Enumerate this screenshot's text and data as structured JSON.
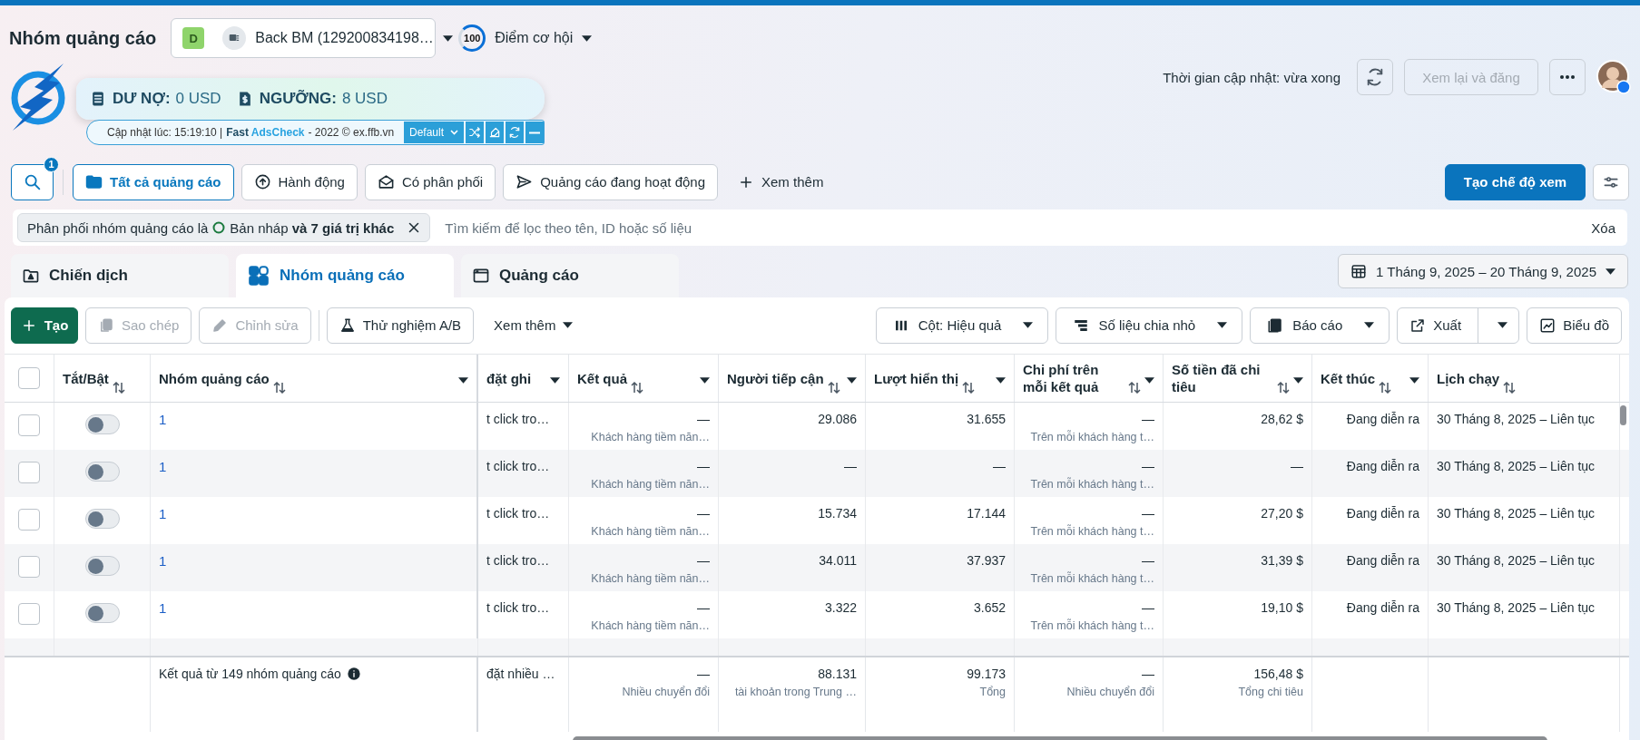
{
  "header": {
    "title": "Nhóm quảng cáo",
    "account": {
      "badge": "D",
      "name": "Back BM (129200834198…"
    },
    "score": {
      "value": "100",
      "label": "Điểm cơ hội"
    },
    "update_time": "Thời gian cập nhật: vừa xong",
    "review_button": {
      "label": "Xem lại và đăng",
      "disabled": true
    }
  },
  "extension": {
    "debt_label": "DƯ NỢ:",
    "debt": "0 USD",
    "threshold_label": "NGƯỠNG:",
    "threshold": "8 USD",
    "updated": "Cập nhật lúc: 15:19:10 |",
    "brand": [
      "Fast",
      "AdsCheck"
    ],
    "credit": "- 2022 © ex.ffb.vn",
    "profile": "Default"
  },
  "view_bar": {
    "search_badge": "1",
    "items": [
      {
        "label": "Tất cả quảng cáo",
        "selected": true
      },
      {
        "label": "Hành động",
        "selected": false
      },
      {
        "label": "Có phân phối",
        "selected": false
      },
      {
        "label": "Quảng cáo đang hoạt động",
        "selected": false
      }
    ],
    "more": "Xem thêm",
    "create_view": "Tạo chế độ xem"
  },
  "filter": {
    "chip_prefix": "Phân phối nhóm quảng cáo là",
    "chip_value": "Bản nháp **và 7 giá trị khác**",
    "placeholder": "Tìm kiếm để lọc theo tên, ID hoặc số liệu",
    "clear": "Xóa"
  },
  "levels": {
    "tabs": [
      {
        "label": "Chiến dịch",
        "selected": false
      },
      {
        "label": "Nhóm quảng cáo",
        "selected": true
      },
      {
        "label": "Quảng cáo",
        "selected": false
      }
    ],
    "date_range": "1 Tháng 9, 2025 – 20 Tháng 9, 2025"
  },
  "actions": {
    "left": [
      {
        "label": "Tạo",
        "kind": "primary",
        "disabled": false
      },
      {
        "label": "Sao chép",
        "kind": "plain",
        "disabled": true
      },
      {
        "label": "Chỉnh sửa",
        "kind": "plain",
        "disabled": true
      },
      {
        "label": "Thử nghiệm A/B",
        "kind": "plain",
        "disabled": false
      },
      {
        "label": "Xem thêm",
        "kind": "ghost",
        "disabled": false
      }
    ],
    "right": [
      {
        "label": "Cột: Hiệu quả",
        "kind": "menu"
      },
      {
        "label": "Số liệu chia nhỏ",
        "kind": "menu"
      },
      {
        "label": "Báo cáo",
        "kind": "menu"
      },
      {
        "label": "Xuất",
        "kind": "split"
      },
      {
        "label": "Biểu đồ",
        "kind": "plain"
      }
    ]
  },
  "table": {
    "columns": [
      {
        "kind": "checkbox",
        "checked": false
      },
      {
        "kind": "text",
        "label": "Tắt/Bật",
        "sortable": true,
        "menu": false
      },
      {
        "kind": "text",
        "label": "Nhóm quảng cáo",
        "sortable": true,
        "menu": true
      },
      {
        "kind": "text",
        "label": "đặt ghi",
        "sortable": false,
        "menu": true
      },
      {
        "kind": "text",
        "label": "Kết quả",
        "sortable": true,
        "menu": true
      },
      {
        "kind": "text",
        "label": "Người tiếp cận",
        "sortable": true,
        "menu": true
      },
      {
        "kind": "text",
        "label": "Lượt hiển thị",
        "sortable": true,
        "menu": true
      },
      {
        "kind": "text",
        "label": "Chi phí trên mỗi kết quả",
        "sortable": true,
        "menu": true
      },
      {
        "kind": "text",
        "label": "Số tiền đã chi tiêu",
        "sortable": true,
        "menu": true
      },
      {
        "kind": "text",
        "label": "Kết thúc",
        "sortable": true,
        "menu": true
      },
      {
        "kind": "text",
        "label": "Lịch chạy",
        "sortable": true,
        "menu": false
      }
    ],
    "rows": [
      {
        "cells": [
          {
            "kind": "checkbox",
            "selected": false
          },
          {
            "kind": "toggle",
            "on": false
          },
          {
            "kind": "link",
            "text": "1"
          },
          {
            "kind": "text",
            "text": "t click tro…"
          },
          {
            "kind": "text",
            "text": "—",
            "sub": "Khách hàng tiềm năn…"
          },
          {
            "kind": "text",
            "text": "29.086"
          },
          {
            "kind": "text",
            "text": "31.655"
          },
          {
            "kind": "text",
            "text": "—",
            "sub": "Trên mỗi khách hàng t…"
          },
          {
            "kind": "text",
            "text": "28,62 $"
          },
          {
            "kind": "text",
            "text": "Đang diễn ra"
          },
          {
            "kind": "text",
            "text": "30 Tháng 8, 2025 – Liên tục"
          }
        ]
      },
      {
        "cells": [
          {
            "kind": "checkbox",
            "selected": false
          },
          {
            "kind": "toggle",
            "on": false
          },
          {
            "kind": "link",
            "text": "1"
          },
          {
            "kind": "text",
            "text": "t click tro…"
          },
          {
            "kind": "text",
            "text": "—",
            "sub": "Khách hàng tiềm năn…"
          },
          {
            "kind": "text",
            "text": "—"
          },
          {
            "kind": "text",
            "text": "—"
          },
          {
            "kind": "text",
            "text": "—",
            "sub": "Trên mỗi khách hàng t…"
          },
          {
            "kind": "text",
            "text": "—"
          },
          {
            "kind": "text",
            "text": "Đang diễn ra"
          },
          {
            "kind": "text",
            "text": "30 Tháng 8, 2025 – Liên tục"
          }
        ]
      },
      {
        "cells": [
          {
            "kind": "checkbox",
            "selected": false
          },
          {
            "kind": "toggle",
            "on": false
          },
          {
            "kind": "link",
            "text": "1"
          },
          {
            "kind": "text",
            "text": "t click tro…"
          },
          {
            "kind": "text",
            "text": "—",
            "sub": "Khách hàng tiềm năn…"
          },
          {
            "kind": "text",
            "text": "15.734"
          },
          {
            "kind": "text",
            "text": "17.144"
          },
          {
            "kind": "text",
            "text": "—",
            "sub": "Trên mỗi khách hàng t…"
          },
          {
            "kind": "text",
            "text": "27,20 $"
          },
          {
            "kind": "text",
            "text": "Đang diễn ra"
          },
          {
            "kind": "text",
            "text": "30 Tháng 8, 2025 – Liên tục"
          }
        ]
      },
      {
        "cells": [
          {
            "kind": "checkbox",
            "selected": false
          },
          {
            "kind": "toggle",
            "on": false
          },
          {
            "kind": "link",
            "text": "1"
          },
          {
            "kind": "text",
            "text": "t click tro…"
          },
          {
            "kind": "text",
            "text": "—",
            "sub": "Khách hàng tiềm năn…"
          },
          {
            "kind": "text",
            "text": "34.011"
          },
          {
            "kind": "text",
            "text": "37.937"
          },
          {
            "kind": "text",
            "text": "—",
            "sub": "Trên mỗi khách hàng t…"
          },
          {
            "kind": "text",
            "text": "31,39 $"
          },
          {
            "kind": "text",
            "text": "Đang diễn ra"
          },
          {
            "kind": "text",
            "text": "30 Tháng 8, 2025 – Liên tục"
          }
        ]
      },
      {
        "cells": [
          {
            "kind": "checkbox",
            "selected": false
          },
          {
            "kind": "toggle",
            "on": false
          },
          {
            "kind": "link",
            "text": "1"
          },
          {
            "kind": "text",
            "text": "t click tro…"
          },
          {
            "kind": "text",
            "text": "—",
            "sub": "Khách hàng tiềm năn…"
          },
          {
            "kind": "text",
            "text": "3.322"
          },
          {
            "kind": "text",
            "text": "3.652"
          },
          {
            "kind": "text",
            "text": "—",
            "sub": "Trên mỗi khách hàng t…"
          },
          {
            "kind": "text",
            "text": "19,10 $"
          },
          {
            "kind": "text",
            "text": "Đang diễn ra"
          },
          {
            "kind": "text",
            "text": "30 Tháng 8, 2025 – Liên tục"
          }
        ]
      }
    ],
    "footer": {
      "summary": "Kết quả từ 149 nhóm quảng cáo",
      "cells": [
        {
          "text": "đặt nhiều …"
        },
        {
          "text": "—",
          "sub": "Nhiều chuyển đổi"
        },
        {
          "text": "88.131",
          "sub": "tài khoản trong Trung …"
        },
        {
          "text": "99.173",
          "sub": "Tổng"
        },
        {
          "text": "—",
          "sub": "Nhiều chuyển đổi"
        },
        {
          "text": "156,48 $",
          "sub": "Tổng chi tiêu"
        }
      ]
    }
  }
}
